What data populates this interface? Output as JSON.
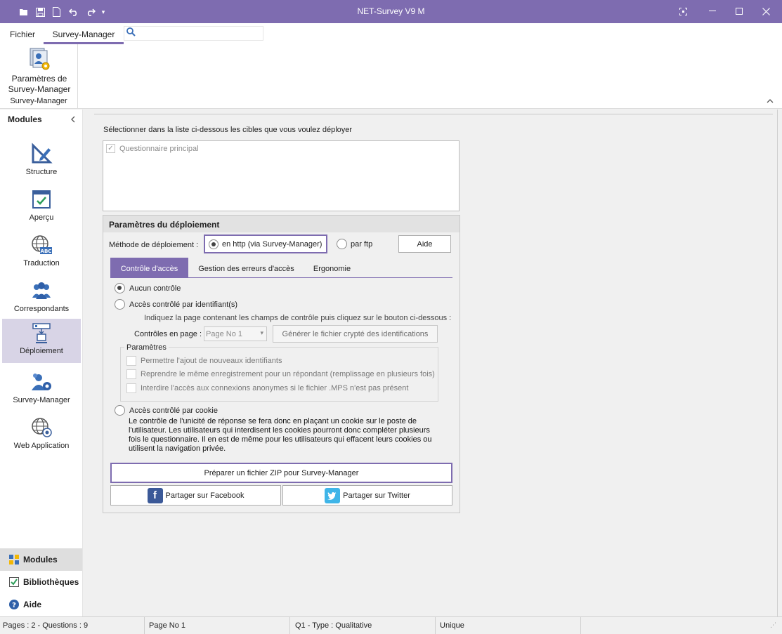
{
  "titlebar": {
    "title": "NET-Survey V9 M",
    "quick_access": [
      "open-folder-icon",
      "save-icon",
      "new-file-icon",
      "undo-icon",
      "redo-icon",
      "customize-dropdown-icon"
    ],
    "window_controls": [
      "fullscreen-icon",
      "minimize-icon",
      "maximize-icon",
      "close-icon"
    ]
  },
  "ribbon": {
    "tabs": [
      {
        "label": "Fichier"
      },
      {
        "label": "Survey-Manager"
      }
    ],
    "search": {
      "placeholder": ""
    },
    "button_line1": "Paramètres de",
    "button_line2": "Survey-Manager",
    "group_label": "Survey-Manager"
  },
  "sidebar": {
    "header": "Modules",
    "modules": [
      {
        "label": "Structure",
        "icon": "structure-icon"
      },
      {
        "label": "Aperçu",
        "icon": "preview-icon"
      },
      {
        "label": "Traduction",
        "icon": "translation-globe-icon"
      },
      {
        "label": "Correspondants",
        "icon": "people-icon"
      },
      {
        "label": "Déploiement",
        "icon": "deployment-icon",
        "active": true
      },
      {
        "label": "Survey-Manager",
        "icon": "survey-manager-icon"
      },
      {
        "label": "Web Application",
        "icon": "web-application-icon"
      }
    ],
    "nav": [
      {
        "label": "Modules",
        "active": true
      },
      {
        "label": "Bibliothèques"
      },
      {
        "label": "Aide"
      }
    ]
  },
  "main": {
    "select_label": "Sélectionner dans la liste ci-dessous les cibles que vous voulez déployer",
    "targets": [
      {
        "label": "Questionnaire principal",
        "checked": true
      }
    ],
    "deploy": {
      "header": "Paramètres du déploiement",
      "method_label": "Méthode de déploiement :",
      "method_http": "en http (via Survey-Manager)",
      "method_ftp": "par ftp",
      "aide_button": "Aide",
      "tabs": [
        {
          "label": "Contrôle d'accès",
          "active": true
        },
        {
          "label": "Gestion des erreurs d'accès"
        },
        {
          "label": "Ergonomie"
        }
      ],
      "access_none": "Aucun contrôle",
      "access_id": "Accès contrôlé par identifiant(s)",
      "instruction": "Indiquez la page contenant les champs de contrôle puis cliquez sur le bouton ci-dessous :",
      "controls_label": "Contrôles en page :",
      "page_select_value": "Page No 1",
      "generate_button": "Générer le fichier crypté des identifications",
      "params_title": "Paramètres",
      "params": [
        "Permettre l'ajout de nouveaux identifiants",
        "Reprendre le même enregistrement pour un répondant (remplissage en plusieurs fois)",
        "Interdire l'accès aux connexions anonymes si le fichier .MPS n'est pas présent"
      ],
      "access_cookie": "Accès contrôlé par cookie",
      "cookie_desc": "Le contrôle de l'unicité de réponse se fera donc en plaçant un cookie sur le poste de l'utilisateur. Les utilisateurs qui interdisent les cookies pourront donc compléter plusieurs fois le questionnaire. Il en est de même pour les utilisateurs qui effacent leurs cookies ou utilisent la navigation privée.",
      "zip_button": "Préparer un fichier ZIP pour Survey-Manager",
      "facebook_button": "Partager sur Facebook",
      "twitter_button": "Partager sur Twitter"
    }
  },
  "statusbar": {
    "pages": "Pages : 2 - Questions : 9",
    "page": "Page No 1",
    "question": "Q1 - Type : Qualitative",
    "mode": "Unique"
  },
  "colors": {
    "accent": "#7e6cb0",
    "active_module_bg": "#d8d4e6"
  }
}
